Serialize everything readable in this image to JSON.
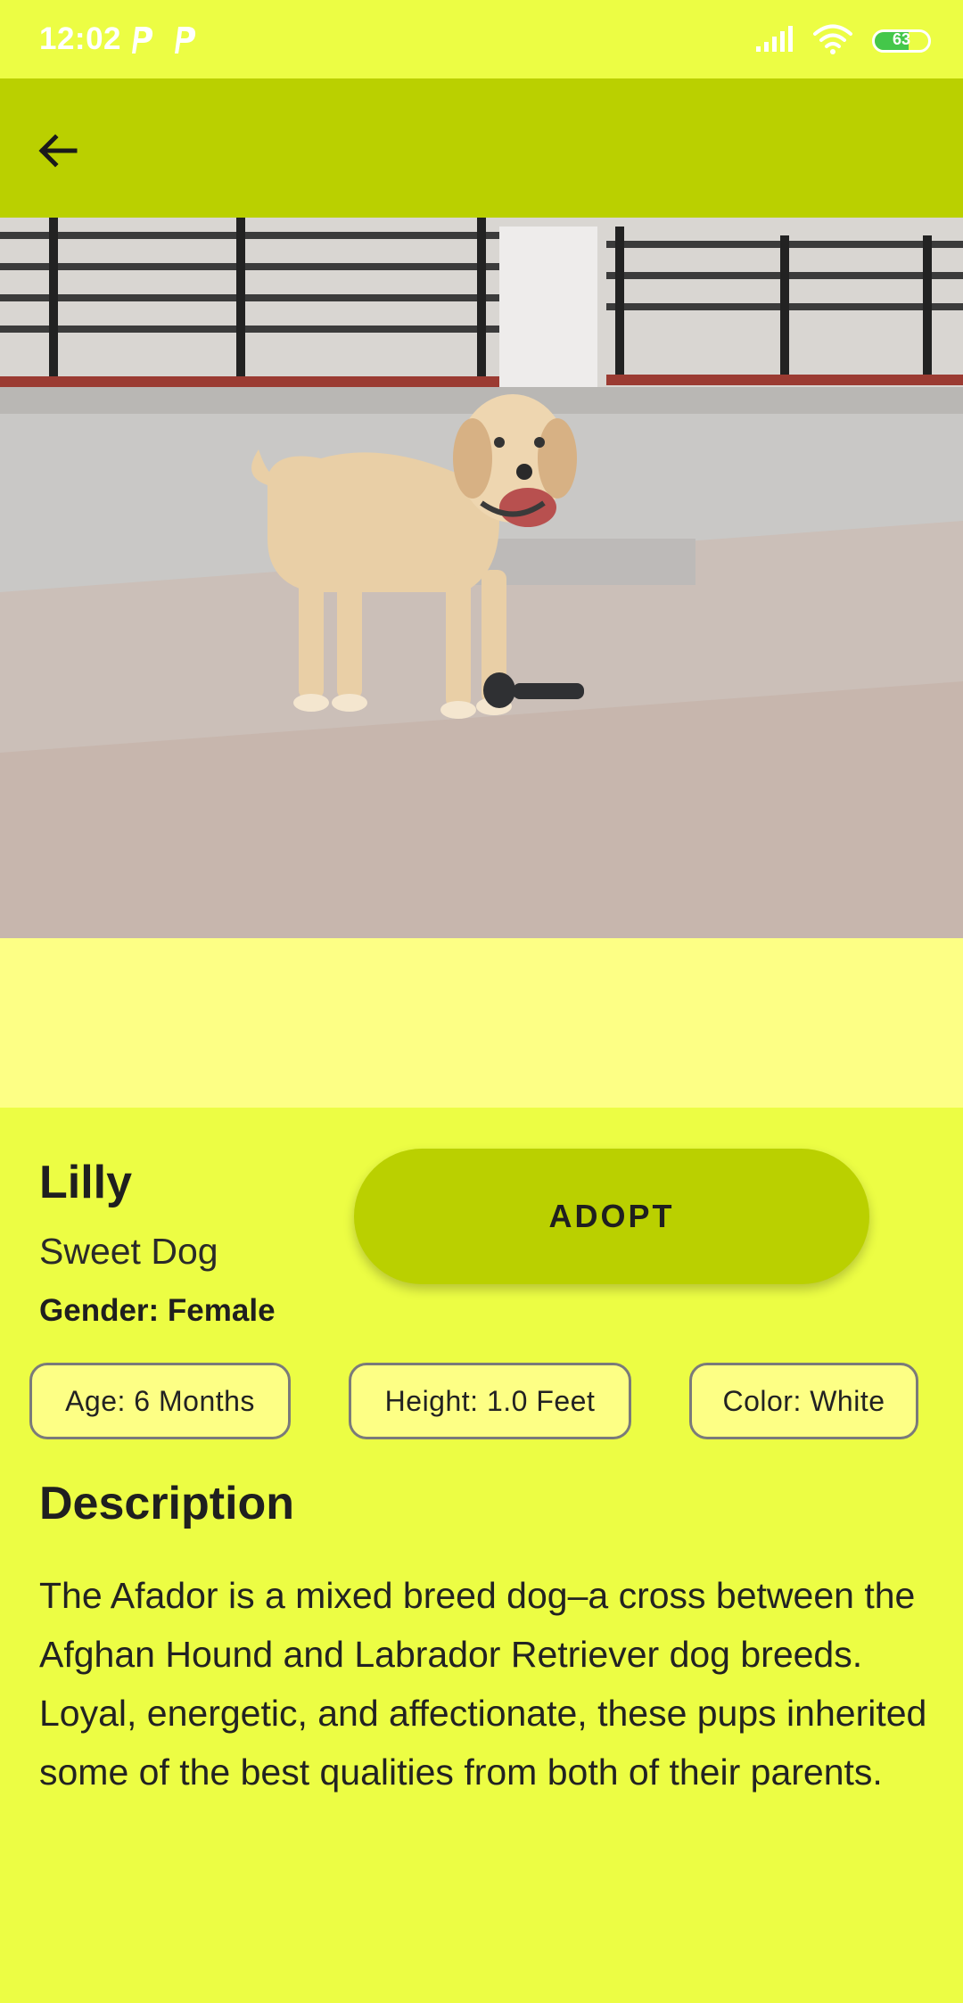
{
  "status_bar": {
    "time": "12:02",
    "battery_level": "63",
    "battery_fraction": 0.63
  },
  "app_bar": {
    "back_icon": "arrow-left-icon"
  },
  "hero": {
    "image_subject": "dog-photo"
  },
  "pet": {
    "name": "Lilly",
    "tagline": "Sweet Dog",
    "gender": "Gender: Female"
  },
  "adopt_button": {
    "label": "ADOPT"
  },
  "chips": {
    "age": "Age: 6 Months",
    "height": "Height: 1.0 Feet",
    "color": "Color: White"
  },
  "description": {
    "title": "Description",
    "body": "The Afador is a mixed breed dog–a cross between the Afghan Hound and Labrador Retriever dog breeds. Loyal, energetic, and affectionate, these pups inherited some of the best qualities from both of their parents."
  },
  "colors": {
    "background": "#ecfd44",
    "app_bar": "#bad000",
    "chip_background": "#fdff85",
    "battery_fill": "#44c74a"
  }
}
